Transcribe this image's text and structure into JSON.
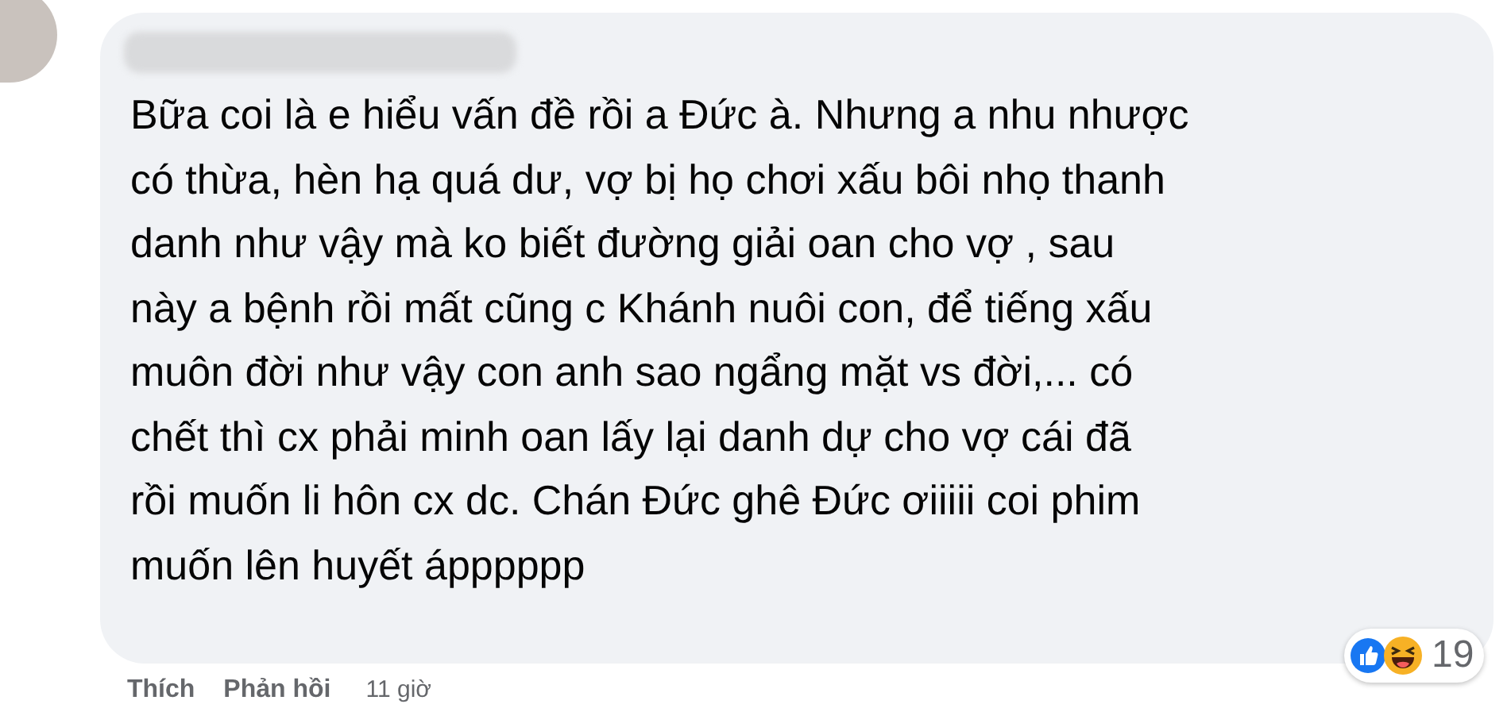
{
  "comment": {
    "text": "Bữa coi là e hiểu vấn đề rồi a Đức à. Nhưng a nhu nhược\ncó thừa, hèn hạ quá dư, vợ bị họ chơi xấu bôi nhọ thanh\ndanh như vậy mà ko biết đường giải oan cho vợ , sau\nnày a bệnh rồi mất cũng c Khánh nuôi con, để tiếng xấu\nmuôn đời như vậy con anh sao ngẩng mặt vs đời,... có\nchết thì cx phải minh oan lấy lại danh dự cho vợ cái đã\nrồi muốn li hôn cx dc. Chán Đức ghê Đức ơiiiii coi phim\nmuốn lên huyết ápppppp",
    "reaction_count": "19"
  },
  "actions": [
    {
      "label": "Thích"
    },
    {
      "label": "Phản hồi"
    }
  ],
  "time": "11 giờ"
}
